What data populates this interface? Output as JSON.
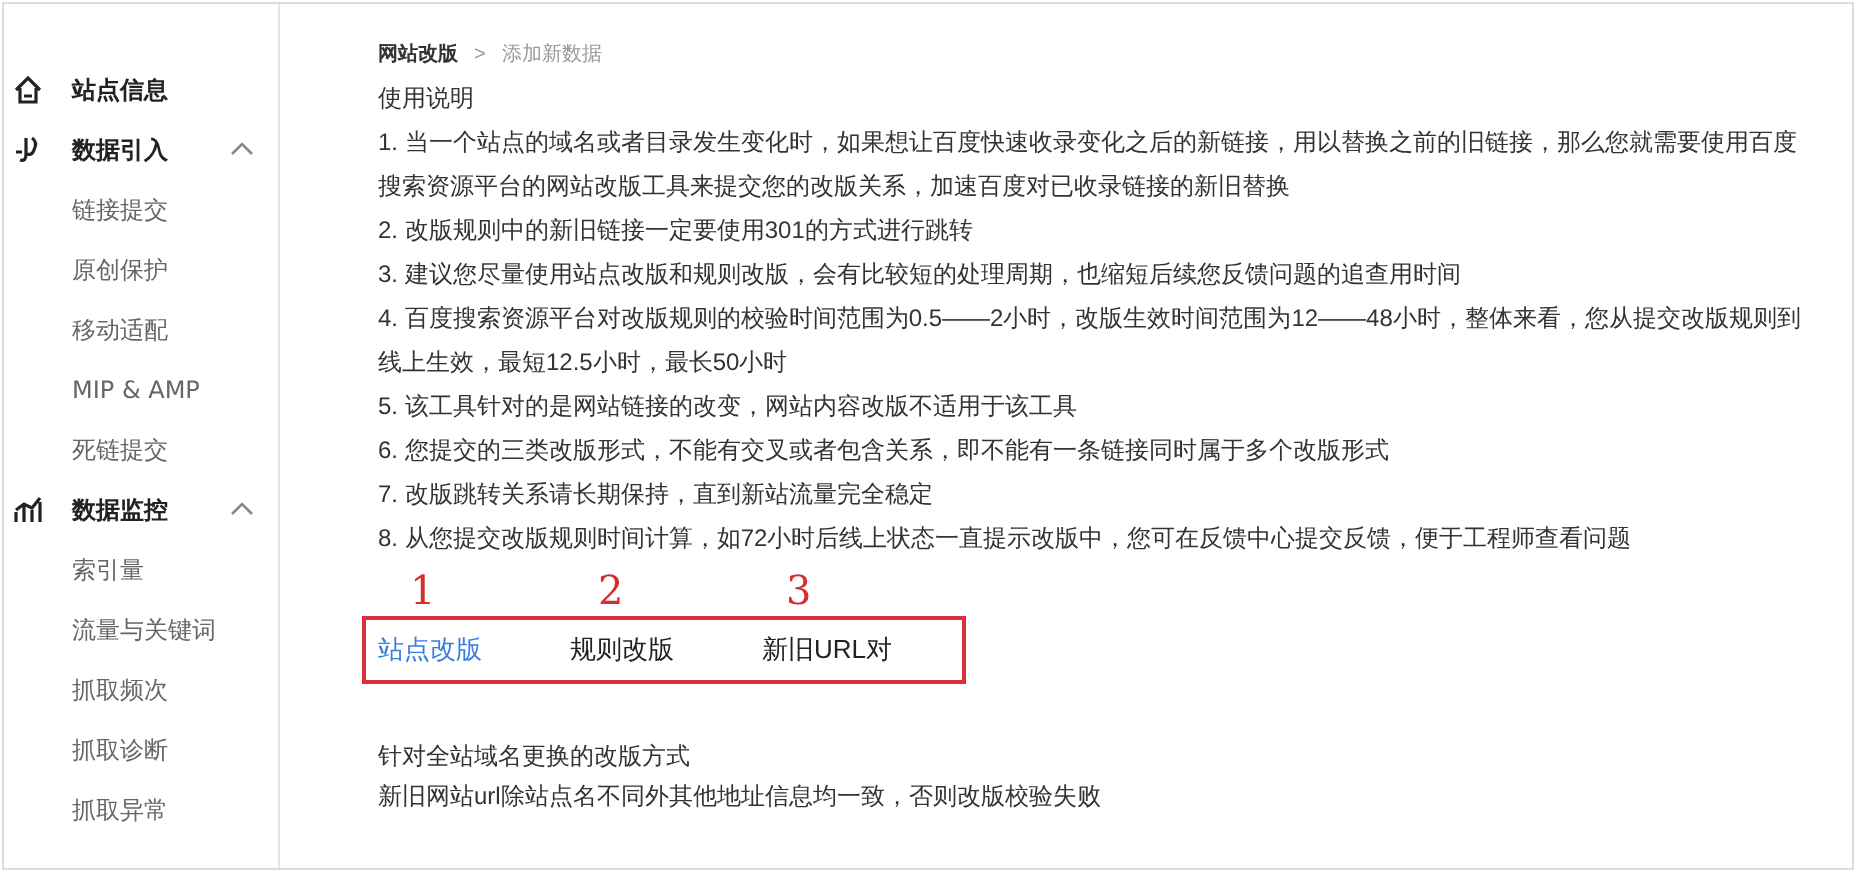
{
  "sidebar": {
    "groups": [
      {
        "title": "站点信息"
      },
      {
        "title": "数据引入",
        "expanded": true,
        "items": [
          "链接提交",
          "原创保护",
          "移动适配",
          "MIP & AMP",
          "死链提交"
        ]
      },
      {
        "title": "数据监控",
        "expanded": true,
        "items": [
          "索引量",
          "流量与关键词",
          "抓取频次",
          "抓取诊断",
          "抓取异常"
        ]
      }
    ]
  },
  "breadcrumb": {
    "parent": "网站改版",
    "separator": ">",
    "current": "添加新数据"
  },
  "instructions": {
    "heading": "使用说明",
    "items": [
      "1. 当一个站点的域名或者目录发生变化时，如果想让百度快速收录变化之后的新链接，用以替换之前的旧链接，那么您就需要使用百度搜索资源平台的网站改版工具来提交您的改版关系，加速百度对已收录链接的新旧替换",
      "2. 改版规则中的新旧链接一定要使用301的方式进行跳转",
      "3. 建议您尽量使用站点改版和规则改版，会有比较短的处理周期，也缩短后续您反馈问题的追查用时间",
      "4. 百度搜索资源平台对改版规则的校验时间范围为0.5——2小时，改版生效时间范围为12——48小时，整体来看，您从提交改版规则到线上生效，最短12.5小时，最长50小时",
      "5. 该工具针对的是网站链接的改变，网站内容改版不适用于该工具",
      "6. 您提交的三类改版形式，不能有交叉或者包含关系，即不能有一条链接同时属于多个改版形式",
      "7. 改版跳转关系请长期保持，直到新站流量完全稳定",
      "8. 从您提交改版规则时间计算，如72小时后线上状态一直提示改版中，您可在反馈中心提交反馈，便于工程师查看问题"
    ]
  },
  "tabs": [
    {
      "label": "站点改版",
      "selected": true,
      "annotation": "1"
    },
    {
      "label": "规则改版",
      "selected": false,
      "annotation": "2"
    },
    {
      "label": "新旧URL对",
      "selected": false,
      "annotation": "3"
    }
  ],
  "description": [
    "针对全站域名更换的改版方式",
    "新旧网站url除站点名不同外其他地址信息均一致，否则改版校验失败"
  ]
}
